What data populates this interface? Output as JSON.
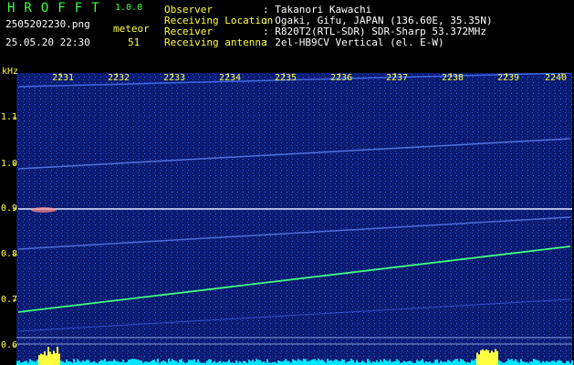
{
  "header": {
    "brand": "HROFFT",
    "version": "1.0.0",
    "filename": "2505202230.png",
    "datetime": "25.05.20 22:30",
    "meteor_label": "meteor",
    "meteor_count": "51",
    "rows": [
      {
        "key": "Observer",
        "value": ": Takanori Kawachi"
      },
      {
        "key": "Receiving Location",
        "value": ": Ogaki, Gifu, JAPAN (136.60E, 35.35N)"
      },
      {
        "key": "Receiver",
        "value": ": R820T2(RTL-SDR) SDR-Sharp 53.372MHz"
      },
      {
        "key": "Receiving antenna",
        "value": ": 2el-HB9CV Vertical (el. E-W)"
      }
    ]
  },
  "spectrogram": {
    "y_unit": "kHz",
    "y_ticks": [
      "1.1",
      "1.0",
      "0.9",
      "0.8",
      "0.7",
      "0.6"
    ],
    "x_ticks": [
      "2231",
      "2232",
      "2233",
      "2234",
      "2235",
      "2236",
      "2237",
      "2238",
      "2239",
      "2240"
    ],
    "colors": {
      "label": "#ffff40",
      "signal": "#40ff80",
      "carrier": "#e0f0ff",
      "noise": "#0a1a6e",
      "level": "#00e5ff"
    }
  }
}
